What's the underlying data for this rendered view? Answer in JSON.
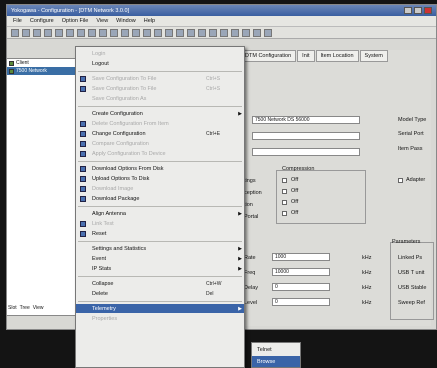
{
  "window": {
    "title": "Yokogawa - Configuration - [DTM Network 3.0.0]",
    "controls": [
      "minimize",
      "maximize",
      "close"
    ]
  },
  "menubar": [
    "File",
    "Configure",
    "Option File",
    "View",
    "Window",
    "Help"
  ],
  "tree": {
    "rows": [
      {
        "label": "Client",
        "selected": false
      },
      {
        "label": "7500 Network",
        "selected": true
      }
    ],
    "tabs": [
      "Slot",
      "Tree",
      "View"
    ]
  },
  "tabs": [
    "DTM Configuration",
    "Init",
    "Item Location",
    "System"
  ],
  "form": {
    "header_value": "7500 Network DS 56000",
    "right_labels": [
      "Model Type",
      "Serial Port",
      "Item Pass"
    ],
    "group_label": "Compression",
    "group_checkboxes": [
      "Off",
      "Off",
      "Off",
      "Off"
    ],
    "side_labels": [
      "tings",
      "ception",
      "tion",
      "Portal"
    ],
    "right_checkbox": "Adapter",
    "bottom_left_labels": [
      "Rate",
      "Freq",
      "Delay",
      "Level"
    ],
    "bottom_values": [
      "1000",
      "10000",
      "0",
      "0"
    ],
    "units": [
      "kHz",
      "kHz",
      "kHz",
      "kHz"
    ],
    "panel_title": "Parameters",
    "panel_labels": [
      "Linked Ps",
      "USB T unit",
      "USB Stable",
      "Sweep Ref"
    ]
  },
  "context_menu": {
    "items": [
      {
        "label": "Login",
        "shortcut": "",
        "arrow": false,
        "disabled": true,
        "highlighted": false,
        "icon": false
      },
      {
        "label": "Logout",
        "shortcut": "",
        "arrow": false,
        "disabled": false,
        "highlighted": false,
        "icon": false
      },
      {
        "label": "Save Configuration To File",
        "shortcut": "Ctrl+S",
        "arrow": false,
        "disabled": true,
        "highlighted": false,
        "icon": true
      },
      {
        "label": "Save Configuration To File",
        "shortcut": "Ctrl+S",
        "arrow": false,
        "disabled": true,
        "highlighted": false,
        "icon": true
      },
      {
        "label": "Save Configuration As",
        "shortcut": "",
        "arrow": false,
        "disabled": true,
        "highlighted": false,
        "icon": false
      },
      {
        "label": "Create Configuration",
        "shortcut": "",
        "arrow": true,
        "disabled": false,
        "highlighted": false,
        "icon": false
      },
      {
        "label": "Delete Configuration From Item",
        "shortcut": "",
        "arrow": false,
        "disabled": true,
        "highlighted": false,
        "icon": true
      },
      {
        "label": "Change Configuration",
        "shortcut": "Ctrl+E",
        "arrow": false,
        "disabled": false,
        "highlighted": false,
        "icon": true
      },
      {
        "label": "Compare Configuration",
        "shortcut": "",
        "arrow": false,
        "disabled": true,
        "highlighted": false,
        "icon": true
      },
      {
        "label": "Apply Configuration To Device",
        "shortcut": "",
        "arrow": false,
        "disabled": true,
        "highlighted": false,
        "icon": true
      },
      {
        "label": "Download Options From Disk",
        "shortcut": "",
        "arrow": false,
        "disabled": false,
        "highlighted": false,
        "icon": true
      },
      {
        "label": "Upload Options To Disk",
        "shortcut": "",
        "arrow": false,
        "disabled": false,
        "highlighted": false,
        "icon": true
      },
      {
        "label": "Download Image",
        "shortcut": "",
        "arrow": false,
        "disabled": true,
        "highlighted": false,
        "icon": true
      },
      {
        "label": "Download Package",
        "shortcut": "",
        "arrow": false,
        "disabled": false,
        "highlighted": false,
        "icon": true
      },
      {
        "label": "Align Antenna",
        "shortcut": "",
        "arrow": true,
        "disabled": false,
        "highlighted": false,
        "icon": false
      },
      {
        "label": "Link Test",
        "shortcut": "",
        "arrow": false,
        "disabled": true,
        "highlighted": false,
        "icon": true
      },
      {
        "label": "Reset",
        "shortcut": "",
        "arrow": false,
        "disabled": false,
        "highlighted": false,
        "icon": true
      },
      {
        "label": "Settings and Statistics",
        "shortcut": "",
        "arrow": true,
        "disabled": false,
        "highlighted": false,
        "icon": false
      },
      {
        "label": "Event",
        "shortcut": "",
        "arrow": true,
        "disabled": false,
        "highlighted": false,
        "icon": false
      },
      {
        "label": "IP Stats",
        "shortcut": "",
        "arrow": true,
        "disabled": false,
        "highlighted": false,
        "icon": false
      },
      {
        "label": "Collapse",
        "shortcut": "Ctrl+W",
        "arrow": false,
        "disabled": false,
        "highlighted": false,
        "icon": false
      },
      {
        "label": "Delete",
        "shortcut": "Del",
        "arrow": false,
        "disabled": false,
        "highlighted": false,
        "icon": false
      },
      {
        "label": "Telemetry",
        "shortcut": "",
        "arrow": true,
        "disabled": false,
        "highlighted": true,
        "icon": false
      },
      {
        "label": "Properties",
        "shortcut": "",
        "arrow": false,
        "disabled": true,
        "highlighted": false,
        "icon": false
      }
    ],
    "separators_after": [
      1,
      4,
      9,
      13,
      16,
      19,
      21
    ]
  },
  "submenu": {
    "items": [
      {
        "label": "Telnet",
        "highlighted": false
      },
      {
        "label": "Browse",
        "highlighted": true
      }
    ]
  }
}
